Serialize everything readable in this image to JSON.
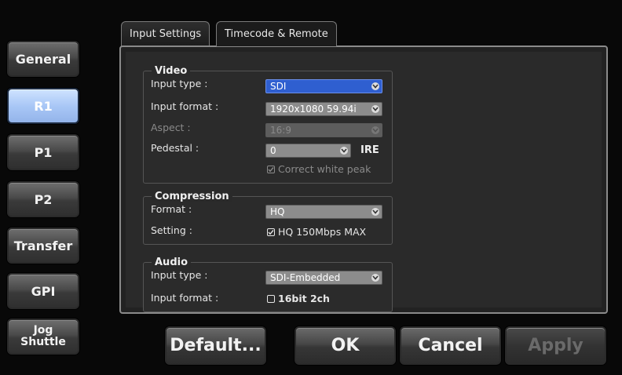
{
  "sidebar": {
    "items": [
      {
        "label": "General"
      },
      {
        "label": "R1"
      },
      {
        "label": "P1"
      },
      {
        "label": "P2"
      },
      {
        "label": "Transfer"
      },
      {
        "label": "GPI"
      },
      {
        "label_line1": "Jog",
        "label_line2": "Shuttle"
      }
    ]
  },
  "tabs": [
    {
      "label": "Input Settings",
      "active": false
    },
    {
      "label": "Timecode & Remote",
      "active": true
    }
  ],
  "video": {
    "title": "Video",
    "input_type_label": "Input type :",
    "input_type_value": "SDI",
    "input_format_label": "Input format :",
    "input_format_value": "1920x1080 59.94i",
    "aspect_label": "Aspect :",
    "aspect_value": "16:9",
    "pedestal_label": "Pedestal :",
    "pedestal_value": "0",
    "pedestal_unit": "IRE",
    "correct_white_peak": "Correct white peak",
    "correct_white_peak_checked": true
  },
  "compression": {
    "title": "Compression",
    "format_label": "Format :",
    "format_value": "HQ",
    "setting_label": "Setting :",
    "setting_value": "HQ 150Mbps MAX",
    "setting_checked": true
  },
  "audio": {
    "title": "Audio",
    "input_type_label": "Input type :",
    "input_type_value": "SDI-Embedded",
    "input_format_label": "Input format :",
    "input_format_value": "16bit 2ch",
    "input_format_checked": false
  },
  "footer": {
    "default_label": "Default...",
    "ok_label": "OK",
    "cancel_label": "Cancel",
    "apply_label": "Apply"
  },
  "colors": {
    "active_nav": "#a9c7f6",
    "active_dropdown": "#2f5fd0"
  }
}
